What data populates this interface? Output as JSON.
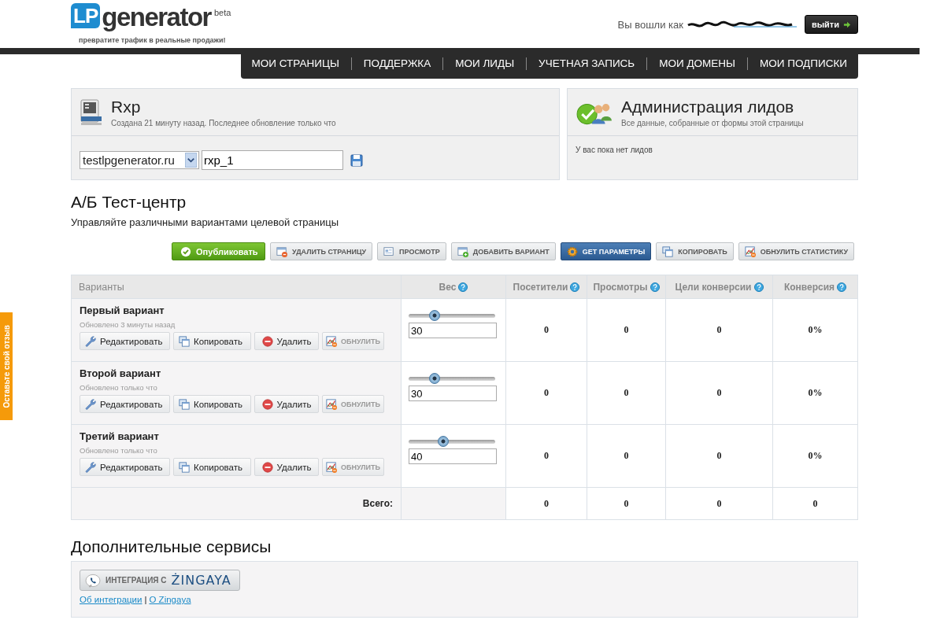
{
  "header": {
    "logo": {
      "mark": "LP",
      "name": "generator",
      "badge": "beta",
      "tagline": "превратите трафик в реальные продажи!"
    },
    "login_label": "Вы вошли как",
    "logout_button": "выйти"
  },
  "nav": [
    {
      "label": "МОИ СТРАНИЦЫ"
    },
    {
      "label": "ПОДДЕРЖКА"
    },
    {
      "label": "МОИ ЛИДЫ"
    },
    {
      "label": "УЧЕТНАЯ ЗАПИСЬ"
    },
    {
      "label": "МОИ ДОМЕНЫ"
    },
    {
      "label": "МОИ ПОДПИСКИ"
    }
  ],
  "page_panel": {
    "title": "Rxp",
    "subtitle": "Создана 21 минуту назад. Последнее обновление только что",
    "domain_select": "testlpgenerator.ru",
    "slug_field": "rxp_1"
  },
  "leads_panel": {
    "title": "Администрация лидов",
    "subtitle": "Все данные, собранные от формы этой страницы",
    "message": "У вас пока нет лидов"
  },
  "ab_test": {
    "title": "А/Б Тест-центр",
    "subtitle": "Управляйте различными вариантами целевой страницы"
  },
  "toolbar": [
    {
      "label": "Опубликовать",
      "kind": "primary"
    },
    {
      "label": "УДАЛИТЬ СТРАНИЦУ",
      "kind": "default"
    },
    {
      "label": "ПРОСМОТР",
      "kind": "default"
    },
    {
      "label": "ДОБАВИТЬ ВАРИАНТ",
      "kind": "default"
    },
    {
      "label": "GET ПАРАМЕТРЫ",
      "kind": "accent"
    },
    {
      "label": "КОПИРОВАТЬ",
      "kind": "default"
    },
    {
      "label": "ОБНУЛИТЬ СТАТИСТИКУ",
      "kind": "default"
    }
  ],
  "table": {
    "columns": [
      {
        "label": "Варианты",
        "help": false
      },
      {
        "label": "Вес",
        "help": true
      },
      {
        "label": "Посетители",
        "help": true
      },
      {
        "label": "Просмотры",
        "help": true
      },
      {
        "label": "Цели конверсии",
        "help": true
      },
      {
        "label": "Конверсия",
        "help": true
      }
    ],
    "rows": [
      {
        "name": "Первый вариант",
        "updated": "Обновлено 3 минуты назад",
        "actions": [
          "Редактировать",
          "Копировать",
          "Удалить",
          "ОБНУЛИТЬ"
        ],
        "weight": {
          "level": 0.3,
          "value": "30"
        },
        "visitors": "0",
        "views": "0",
        "goals": "0",
        "conversion": "0%"
      },
      {
        "name": "Второй вариант",
        "updated": "Обновлено только что",
        "actions": [
          "Редактировать",
          "Копировать",
          "Удалить",
          "ОБНУЛИТЬ"
        ],
        "weight": {
          "level": 0.3,
          "value": "30"
        },
        "visitors": "0",
        "views": "0",
        "goals": "0",
        "conversion": "0%"
      },
      {
        "name": "Третий вариант",
        "updated": "Обновлено только что",
        "actions": [
          "Редактировать",
          "Копировать",
          "Удалить",
          "ОБНУЛИТЬ"
        ],
        "weight": {
          "level": 0.4,
          "value": "40"
        },
        "visitors": "0",
        "views": "0",
        "goals": "0",
        "conversion": "0%"
      }
    ],
    "total": {
      "label": "Всего:",
      "cells": [
        "0",
        "0",
        "0",
        "0"
      ]
    }
  },
  "services": {
    "title": "Дополнительные сервисы",
    "integration_button": {
      "label": "ИНТЕГРАЦИЯ С",
      "brand": "ŻINGAYA"
    },
    "links": [
      "Об интеграции",
      "О Zingaya"
    ],
    "separator": "|"
  },
  "feedback_tab": "Оставьте свой отзыв"
}
